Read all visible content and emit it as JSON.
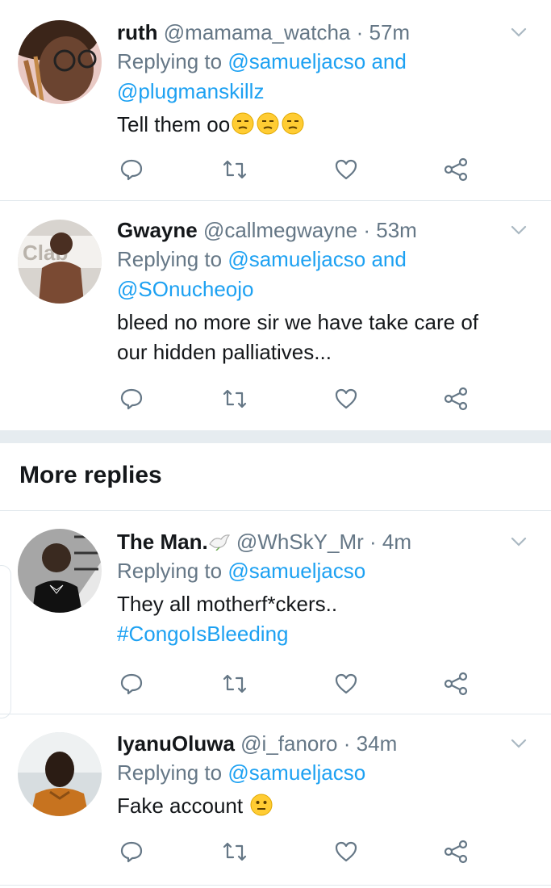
{
  "tweets": [
    {
      "name": "ruth",
      "handle": "@mamama_watcha",
      "dot": "·",
      "time": "57m",
      "replying_prefix": "Replying to ",
      "mention1": "@samueljacso",
      "and": " and",
      "mention2": "@plugmanskillz",
      "text": "Tell them oo",
      "emoji": "unamused-face-icon ×3"
    },
    {
      "name": "Gwayne",
      "handle": "@callmegwayne",
      "dot": "·",
      "time": "53m",
      "replying_prefix": "Replying to ",
      "mention1": "@samueljacso",
      "and": " and",
      "mention2": "@SOnucheojo",
      "text_line1": "bleed no more sir we have take care of",
      "text_line2": "our hidden palliatives..."
    },
    {
      "name": "The Man.",
      "handle": "@WhSkY_Mr",
      "dot": "·",
      "time": "4m",
      "replying_prefix": "Replying to ",
      "mention1": "@samueljacso",
      "text_line1": "They all motherf*ckers..",
      "hashtag": "#CongoIsBleeding"
    },
    {
      "name": "IyanuOluwa",
      "handle": "@i_fanoro",
      "dot": "·",
      "time": "34m",
      "replying_prefix": "Replying to ",
      "mention1": "@samueljacso",
      "text": "Fake account "
    }
  ],
  "section": {
    "title": "More replies"
  },
  "colors": {
    "link": "#1da1f2",
    "muted": "#657786",
    "text": "#14171a",
    "divider": "#e1e8ed",
    "band": "#e6ecf0"
  },
  "icons": [
    "reply-icon",
    "retweet-icon",
    "like-icon",
    "share-icon",
    "chevron-down-icon"
  ]
}
